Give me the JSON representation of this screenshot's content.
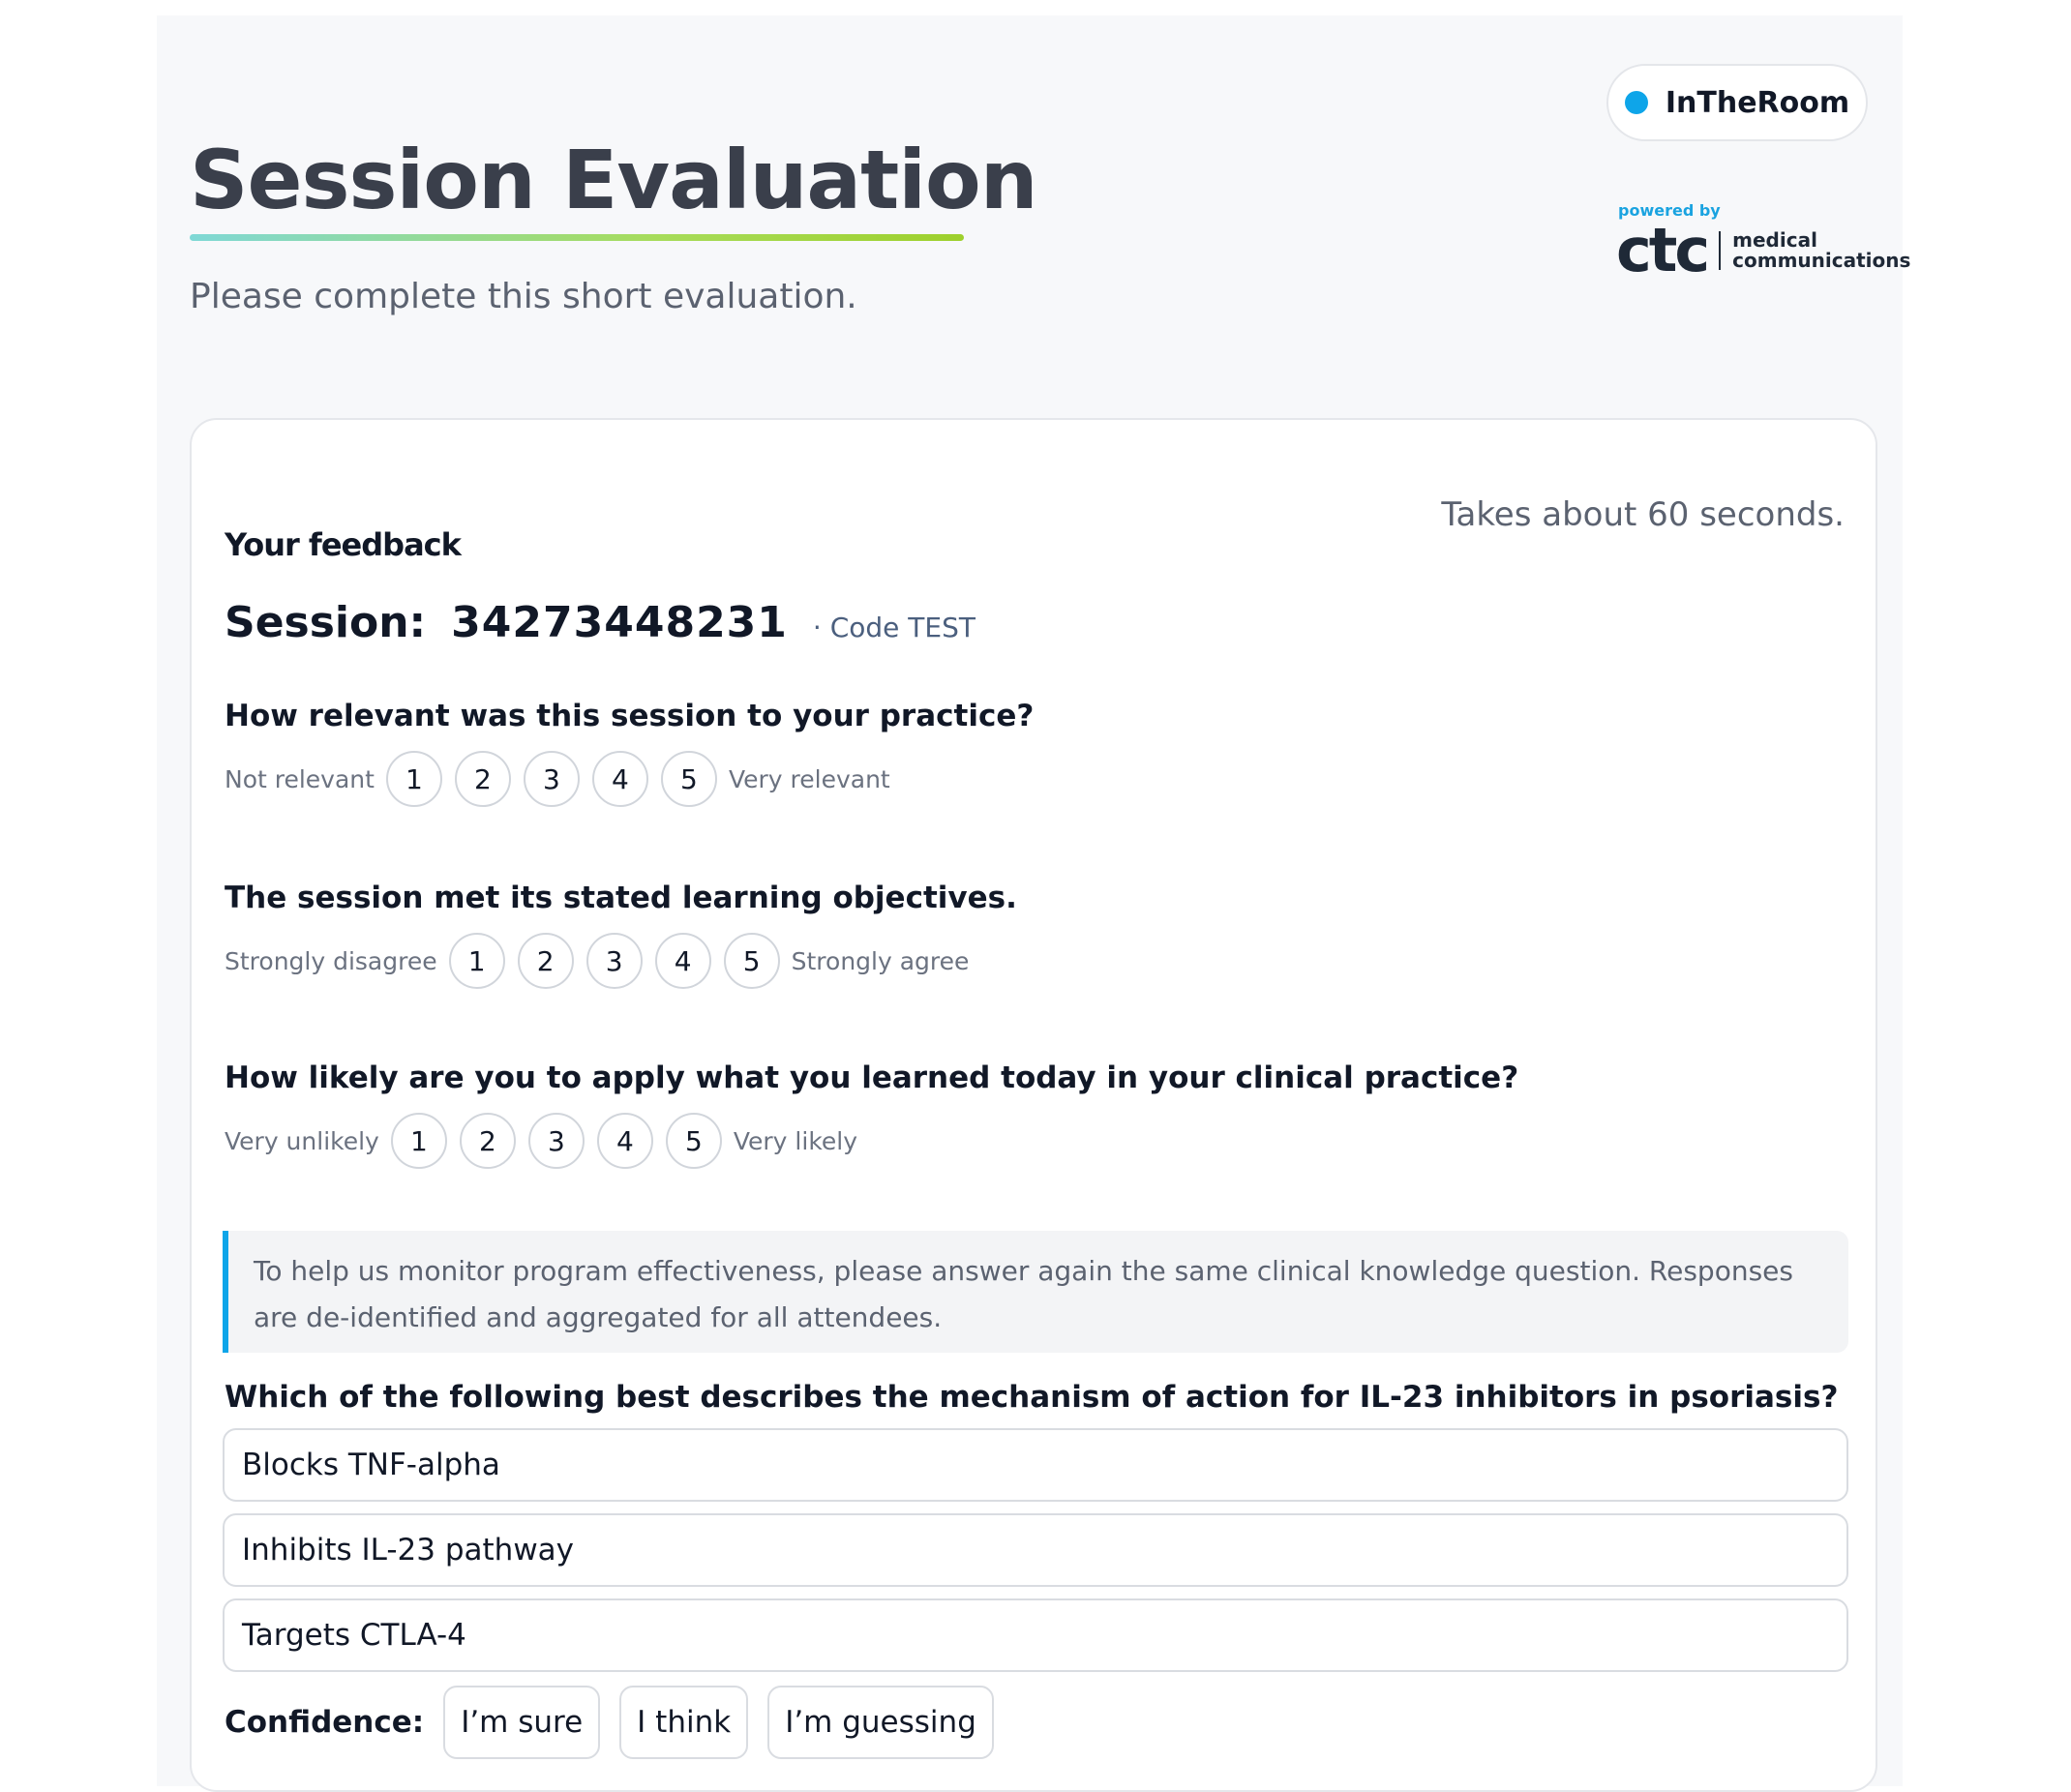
{
  "header": {
    "title": "Session Evaluation",
    "subtitle": "Please complete this short evaluation."
  },
  "brand": {
    "name": "InTheRoom",
    "dot_color": "#0ea5e9",
    "powered_by": "powered by",
    "logo_word": "ctc",
    "logo_line1": "medical",
    "logo_line2": "communications"
  },
  "card": {
    "duration": "Takes about 60 seconds.",
    "heading": "Your feedback",
    "session_label": "Session:",
    "session_number": "34273448231",
    "session_code": "· Code TEST"
  },
  "questions": [
    {
      "text": "How relevant was this session to your practice?",
      "low_label": "Not relevant",
      "high_label": "Very relevant",
      "options": [
        "1",
        "2",
        "3",
        "4",
        "5"
      ]
    },
    {
      "text": "The session met its stated learning objectives.",
      "low_label": "Strongly disagree",
      "high_label": "Strongly agree",
      "options": [
        "1",
        "2",
        "3",
        "4",
        "5"
      ]
    },
    {
      "text": "How likely are you to apply what you learned today in your clinical practice?",
      "low_label": "Very unlikely",
      "high_label": "Very likely",
      "options": [
        "1",
        "2",
        "3",
        "4",
        "5"
      ]
    }
  ],
  "notice": {
    "text": "To help us monitor program effectiveness, please answer again the same clinical knowledge question. Responses are de-identified and aggregated for all attendees.",
    "accent_color": "#0ea5e9"
  },
  "knowledge": {
    "question": "Which of the following best describes the mechanism of action for IL-23 inhibitors in psoriasis?",
    "options": [
      "Blocks TNF-alpha",
      "Inhibits IL-23 pathway",
      "Targets CTLA-4"
    ]
  },
  "confidence": {
    "label": "Confidence:",
    "options": [
      "I’m sure",
      "I think",
      "I’m guessing"
    ]
  }
}
